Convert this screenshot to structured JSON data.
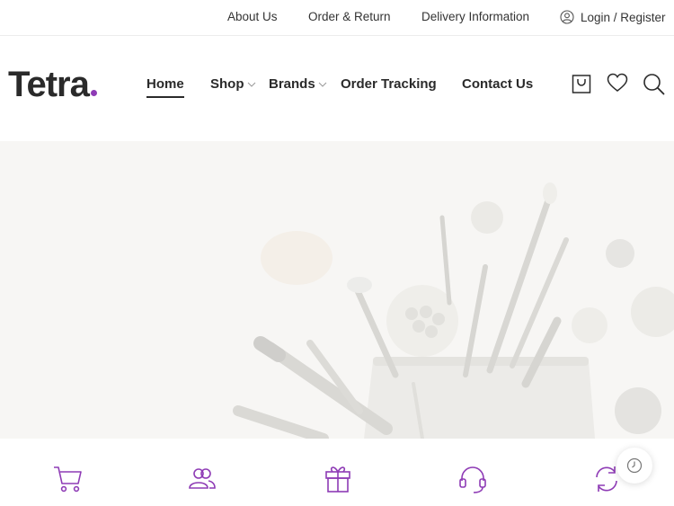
{
  "topbar": {
    "about": "About Us",
    "order_return": "Order & Return",
    "delivery": "Delivery Information",
    "login": "Login / Register"
  },
  "logo": {
    "text": "Tetra",
    "dot_color": "#8e3bb5"
  },
  "nav": {
    "home": "Home",
    "shop": "Shop",
    "brands": "Brands",
    "tracking": "Order Tracking",
    "contact": "Contact Us",
    "active": "Home"
  },
  "header_icons": [
    "cart-bag-icon",
    "heart-icon",
    "search-icon"
  ],
  "feature_icons": [
    "shopping-cart-icon",
    "users-icon",
    "gift-icon",
    "headset-icon",
    "refresh-icon"
  ],
  "float_button_icon": "clock-icon",
  "colors": {
    "accent": "#8e3bb5",
    "text": "#2a2a2a"
  }
}
